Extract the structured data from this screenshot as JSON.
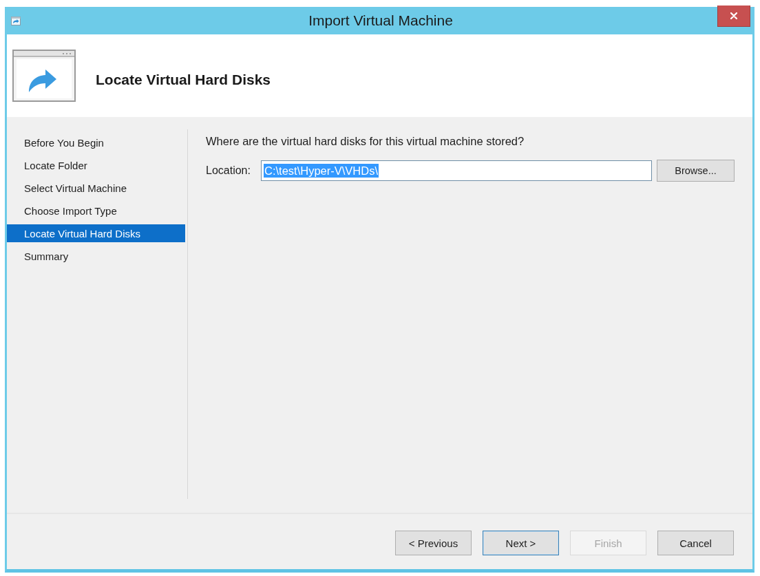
{
  "window": {
    "title": "Import Virtual Machine"
  },
  "header": {
    "title": "Locate Virtual Hard Disks"
  },
  "sidebar": {
    "items": [
      {
        "label": "Before You Begin",
        "selected": false
      },
      {
        "label": "Locate Folder",
        "selected": false
      },
      {
        "label": "Select Virtual Machine",
        "selected": false
      },
      {
        "label": "Choose Import Type",
        "selected": false
      },
      {
        "label": "Locate Virtual Hard Disks",
        "selected": true
      },
      {
        "label": "Summary",
        "selected": false
      }
    ]
  },
  "page": {
    "question": "Where are the virtual hard disks for this virtual machine stored?",
    "location": {
      "label": "Location:",
      "value": "C:\\test\\Hyper-V\\VHDs\\",
      "value_selected": true
    },
    "browse_button": "Browse..."
  },
  "buttons": [
    {
      "label": "< Previous",
      "default": false,
      "disabled": false
    },
    {
      "label": "Next >",
      "default": true,
      "disabled": false
    },
    {
      "label": "Finish",
      "default": false,
      "disabled": true
    },
    {
      "label": "Cancel",
      "default": false,
      "disabled": false
    }
  ]
}
